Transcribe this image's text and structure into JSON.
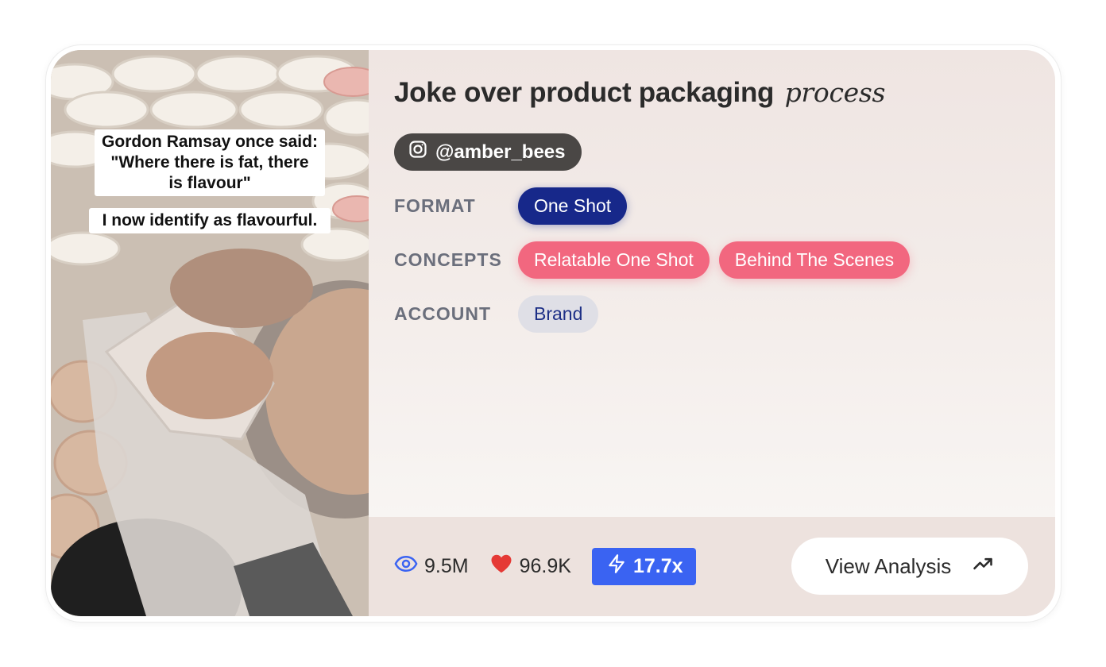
{
  "thumbnail": {
    "caption_lines": [
      "Gordon Ramsay once said:",
      "\"Where there is fat, there",
      "is flavour\""
    ],
    "caption_second": "I now identify as flavourful."
  },
  "title": {
    "main": "Joke over product packaging",
    "accent": "process"
  },
  "account_handle": {
    "icon": "instagram-icon",
    "text": "@amber_bees"
  },
  "format": {
    "label": "FORMAT",
    "value": "One Shot"
  },
  "concepts": {
    "label": "CONCEPTS",
    "items": [
      "Relatable One Shot",
      "Behind The Scenes"
    ]
  },
  "account": {
    "label": "ACCOUNT",
    "value": "Brand"
  },
  "stats": {
    "views": "9.5M",
    "likes": "96.9K",
    "multiplier": "17.7x"
  },
  "cta": {
    "label": "View Analysis",
    "icon": "trending-up-icon"
  },
  "colors": {
    "format_pill": "#17288a",
    "concept_pill": "#f2677f",
    "boost_badge": "#3a63f2",
    "heart": "#e53935",
    "eye": "#3a63f2"
  }
}
